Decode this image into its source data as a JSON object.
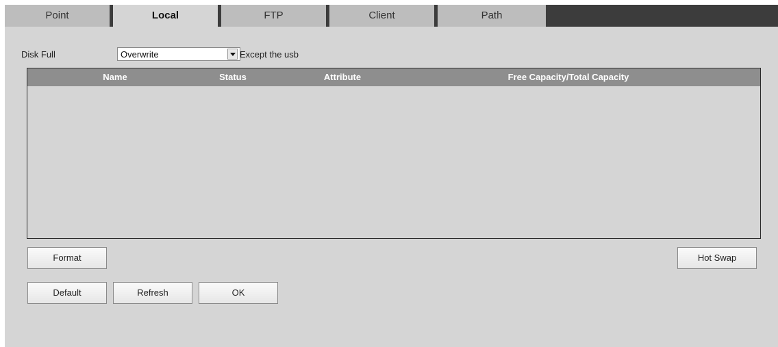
{
  "tabs": [
    {
      "label": "Point",
      "active": false
    },
    {
      "label": "Local",
      "active": true
    },
    {
      "label": "FTP",
      "active": false
    },
    {
      "label": "Client",
      "active": false
    },
    {
      "label": "Path",
      "active": false
    }
  ],
  "disk_full": {
    "label": "Disk Full",
    "selected": "Overwrite",
    "note": "Except the usb"
  },
  "table": {
    "columns": [
      "Name",
      "Status",
      "Attribute",
      "Free Capacity/Total Capacity"
    ],
    "rows": []
  },
  "buttons": {
    "format": "Format",
    "hot_swap": "Hot Swap",
    "default": "Default",
    "refresh": "Refresh",
    "ok": "OK"
  }
}
